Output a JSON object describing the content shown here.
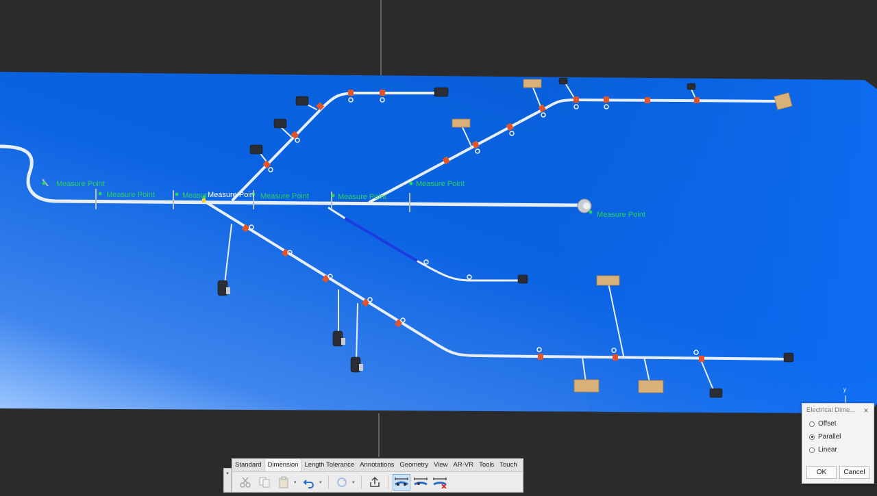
{
  "viewport": {
    "measure_point_label": "Measure Point",
    "measure_point_partial": "Measur",
    "measure_point_short": "Measure",
    "measure_point_partial2": "Measure Poin",
    "axis_label": "y"
  },
  "dialog": {
    "title": "Electrical Dime...",
    "close": "×",
    "options": [
      {
        "label": "Offset",
        "selected": false
      },
      {
        "label": "Parallel",
        "selected": true
      },
      {
        "label": "Linear",
        "selected": false
      }
    ],
    "ok": "OK",
    "cancel": "Cancel"
  },
  "ribbon": {
    "tabs": [
      "Standard",
      "Dimension",
      "Length Tolerance",
      "Annotations",
      "Geometry",
      "View",
      "AR-VR",
      "Tools",
      "Touch"
    ],
    "active_tab": "Dimension",
    "tools": [
      "cut-icon",
      "copy-icon",
      "paste-icon",
      "undo-icon",
      "refresh-icon",
      "export-icon",
      "dimension-parallel-icon",
      "dimension-offset-icon",
      "dimension-delete-icon"
    ],
    "handle_glyph": "▾"
  },
  "colors": {
    "board": "#0a66e6",
    "background": "#2b2b2b",
    "wire": "#e8eef5",
    "clip": "#e2552a",
    "connector": "#2a2d33",
    "label": "#2ad15a",
    "block": "#d8b07a"
  }
}
